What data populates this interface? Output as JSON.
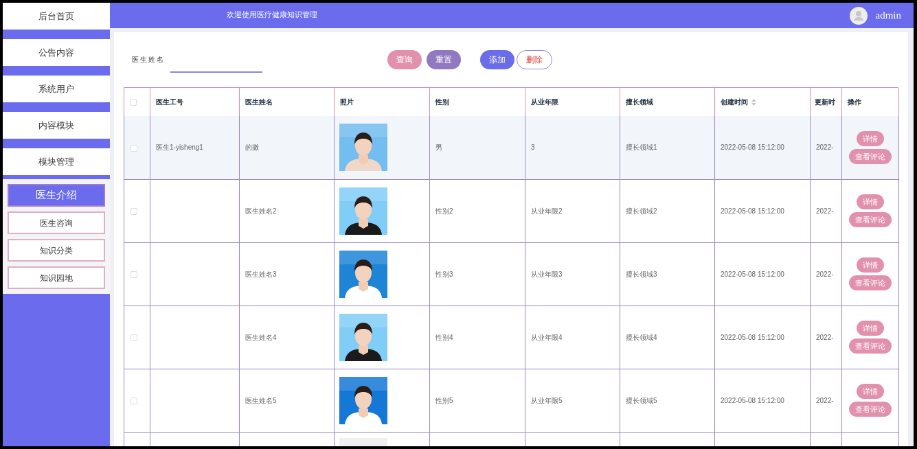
{
  "sidebar": {
    "items": [
      {
        "label": "后台首页"
      },
      {
        "label": "公告内容"
      },
      {
        "label": "系统用户"
      },
      {
        "label": "内容模块"
      },
      {
        "label": "模块管理"
      }
    ],
    "submenu": [
      {
        "label": "医生介绍",
        "selected": true
      },
      {
        "label": "医生咨询",
        "selected": false
      },
      {
        "label": "知识分类",
        "selected": false
      },
      {
        "label": "知识园地",
        "selected": false
      }
    ]
  },
  "header": {
    "title": "欢迎使用医疗健康知识管理",
    "user": "admin"
  },
  "search": {
    "label": "医生姓名",
    "buttons": [
      {
        "label": "查询",
        "kind": "search"
      },
      {
        "label": "重置",
        "kind": "reset"
      },
      {
        "label": "添加",
        "kind": "add"
      },
      {
        "label": "删除",
        "kind": "delete"
      }
    ]
  },
  "table": {
    "select_all": {
      "checked": false
    },
    "columns": [
      {
        "label": "医生工号"
      },
      {
        "label": "医生姓名"
      },
      {
        "label": "照片"
      },
      {
        "label": "性别"
      },
      {
        "label": "从业年限"
      },
      {
        "label": "擅长领域"
      },
      {
        "label": "创建时间",
        "sortable": true
      },
      {
        "label": "更新时"
      },
      {
        "label": "操作"
      }
    ],
    "rows": [
      {
        "checked": false,
        "highlighted": true,
        "cells": [
          "医生1-yisheng1",
          "的撒",
          "",
          "男",
          "3",
          "擅长领域1",
          "2022-05-08 15:12:00",
          "2022-"
        ],
        "actions": [
          "详情",
          "查看评论"
        ]
      },
      {
        "checked": false,
        "highlighted": false,
        "cells": [
          "",
          "医生姓名2",
          "",
          "性别2",
          "从业年限2",
          "擅长领域2",
          "2022-05-08 15:12:00",
          "2022-"
        ],
        "actions": [
          "详情",
          "查看评论"
        ]
      },
      {
        "checked": false,
        "highlighted": false,
        "cells": [
          "",
          "医生姓名3",
          "",
          "性别3",
          "从业年限3",
          "擅长领域3",
          "2022-05-08 15:12:00",
          "2022-"
        ],
        "actions": [
          "详情",
          "查看评论"
        ]
      },
      {
        "checked": false,
        "highlighted": false,
        "cells": [
          "",
          "医生姓名4",
          "",
          "性别4",
          "从业年限4",
          "擅长领域4",
          "2022-05-08 15:12:00",
          "2022-"
        ],
        "actions": [
          "详情",
          "查看评论"
        ]
      },
      {
        "checked": false,
        "highlighted": false,
        "cells": [
          "",
          "医生姓名5",
          "",
          "性别5",
          "从业年限5",
          "擅长领域5",
          "2022-05-08 15:12:00",
          "2022-"
        ],
        "actions": [
          "详情",
          "查看评论"
        ]
      }
    ]
  }
}
